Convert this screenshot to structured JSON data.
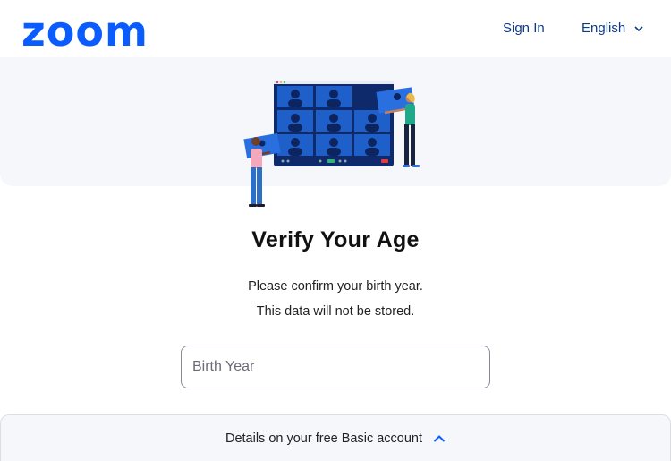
{
  "header": {
    "logo_text": "zoom",
    "sign_in_label": "Sign In",
    "language_label": "English"
  },
  "main": {
    "title": "Verify Your Age",
    "line1": "Please confirm your birth year.",
    "line2": "This data will not be stored.",
    "birth_year": {
      "value": "",
      "placeholder": "Birth Year"
    }
  },
  "footer": {
    "details_label": "Details on your free Basic account"
  },
  "colors": {
    "brand": "#0b5cff",
    "nav_text": "#0e3a8a",
    "hero_bg": "#f6f7fb"
  },
  "icons": {
    "language_chevron": "chevron-down-icon",
    "footer_chevron": "chevron-up-icon"
  }
}
